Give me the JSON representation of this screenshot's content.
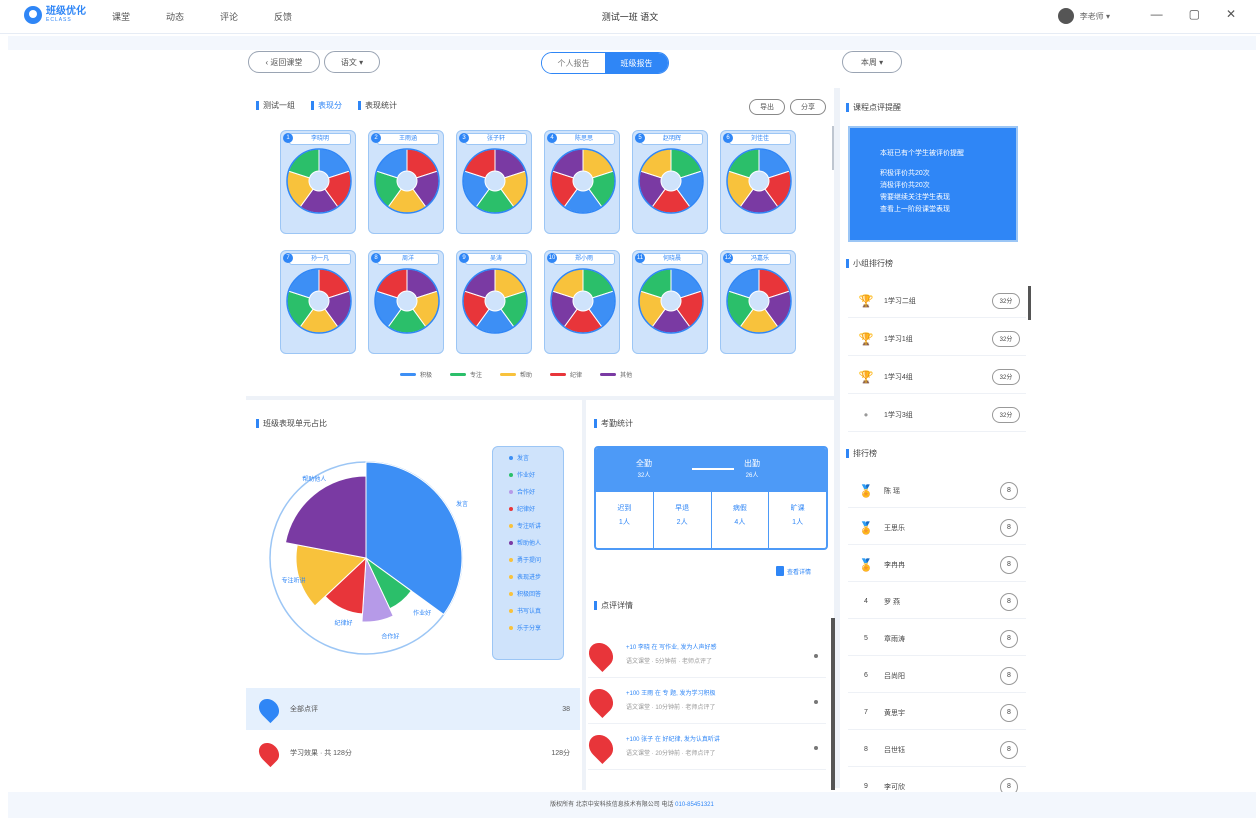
{
  "app": {
    "logo_text": "班级优化",
    "logo_sub": "ECLASS",
    "nav": [
      "课堂",
      "动态",
      "评论",
      "反馈"
    ],
    "window_title": "测试一班 语文",
    "user_name": "李老师 ▾"
  },
  "toolbar": {
    "back": "‹ 返回课堂",
    "subject": "语文 ▾",
    "seg_personal": "个人报告",
    "seg_class": "班级报告",
    "period": "本周 ▾"
  },
  "dist": {
    "tabs": [
      "测试一组",
      "表现分",
      "表现统计"
    ],
    "btn_a": "导出",
    "btn_b": "分享",
    "cards": [
      {
        "name": "李晓明",
        "n": "1"
      },
      {
        "name": "王雨涵",
        "n": "2"
      },
      {
        "name": "张子轩",
        "n": "3"
      },
      {
        "name": "陈思思",
        "n": "4"
      },
      {
        "name": "赵明辉",
        "n": "5"
      },
      {
        "name": "刘佳佳",
        "n": "6"
      },
      {
        "name": "孙一凡",
        "n": "7"
      },
      {
        "name": "周洋",
        "n": "8"
      },
      {
        "name": "吴涛",
        "n": "9"
      },
      {
        "name": "郑小雨",
        "n": "10"
      },
      {
        "name": "何晓晨",
        "n": "11"
      },
      {
        "name": "冯嘉乐",
        "n": "12"
      }
    ],
    "legend": [
      "积极",
      "专注",
      "帮助",
      "纪律",
      "其他"
    ]
  },
  "colors": {
    "blue": "#3d8ff5",
    "green": "#2bbf6a",
    "yellow": "#f8c23c",
    "red": "#e8353a",
    "purple": "#7a3aa3",
    "lilac": "#b69ae8"
  },
  "pie": {
    "title": "班级表现单元占比",
    "labels": [
      "发言",
      "作业好",
      "合作好",
      "纪律好",
      "专注听讲",
      "帮助他人"
    ],
    "legend_items": [
      "发言",
      "作业好",
      "合作好",
      "纪律好",
      "专注听讲",
      "帮助他人",
      "勇于提问",
      "表现进步",
      "积极回答",
      "书写认真",
      "乐于分享"
    ]
  },
  "pie_chart": {
    "title": "班级表现单元占比",
    "chart_data": {
      "type": "pie",
      "categories": [
        "发言",
        "作业好",
        "合作好",
        "纪律好",
        "专注听讲",
        "帮助他人"
      ],
      "values": [
        35,
        8,
        8,
        12,
        15,
        22
      ]
    }
  },
  "week": {
    "title": "考勤统计",
    "label_a": "全勤",
    "label_a_sub": "32人",
    "label_b": "出勤",
    "label_b_sub": "26人",
    "cells": [
      {
        "k": "迟到",
        "v": "1人"
      },
      {
        "k": "早退",
        "v": "2人"
      },
      {
        "k": "病假",
        "v": "4人"
      },
      {
        "k": "旷课",
        "v": "1人"
      }
    ],
    "view_detail": "查看详情"
  },
  "dynamics": {
    "title": "点评详情",
    "rows": [
      {
        "t1": "+10 李晓 在 写作业, 发为人声好感",
        "t2": "语文课堂 · 5分钟前 · 老师点评了"
      },
      {
        "t1": "+100 王雨 在 专 题, 发为学习积极",
        "t2": "语文课堂 · 10分钟前 · 老师点评了"
      },
      {
        "t1": "+100 张子 在 好纪律, 发为认真听讲",
        "t2": "语文课堂 · 20分钟前 · 老师点评了"
      }
    ]
  },
  "left_list": [
    {
      "label": "全部点评",
      "value": "38"
    },
    {
      "label": "学习效果 · 共 128分",
      "value": "128分"
    }
  ],
  "sidebar": {
    "notice_title": "课程点评提醒",
    "notice_lines": [
      "本班已有个学生被评价提醒",
      "积极评价共20次",
      "消极评价共20次",
      "需要继续关注学生表现",
      "查看上一阶段课堂表现"
    ],
    "group_title": "小组排行榜",
    "groups": [
      {
        "label": "1学习二组",
        "btn": "32分"
      },
      {
        "label": "1学习1组",
        "btn": "32分"
      },
      {
        "label": "1学习4组",
        "btn": "32分"
      },
      {
        "label": "1学习3组",
        "btn": "32分"
      }
    ],
    "rank_title": "排行榜",
    "ranks": [
      {
        "label": "陈 瑶",
        "n": "8"
      },
      {
        "label": "王思乐",
        "n": "8"
      },
      {
        "label": "李冉冉",
        "n": "8"
      },
      {
        "label": "罗 燕",
        "n": "8"
      },
      {
        "label": "章雨涛",
        "n": "8"
      },
      {
        "label": "吕尚阳",
        "n": "8"
      },
      {
        "label": "黄思宇",
        "n": "8"
      },
      {
        "label": "吕世钰",
        "n": "8"
      },
      {
        "label": "李可欣",
        "n": "8"
      }
    ]
  },
  "footer": {
    "text": "版权所有 北京中安科技信息技术有限公司 电话",
    "phone": "010-85451321"
  }
}
